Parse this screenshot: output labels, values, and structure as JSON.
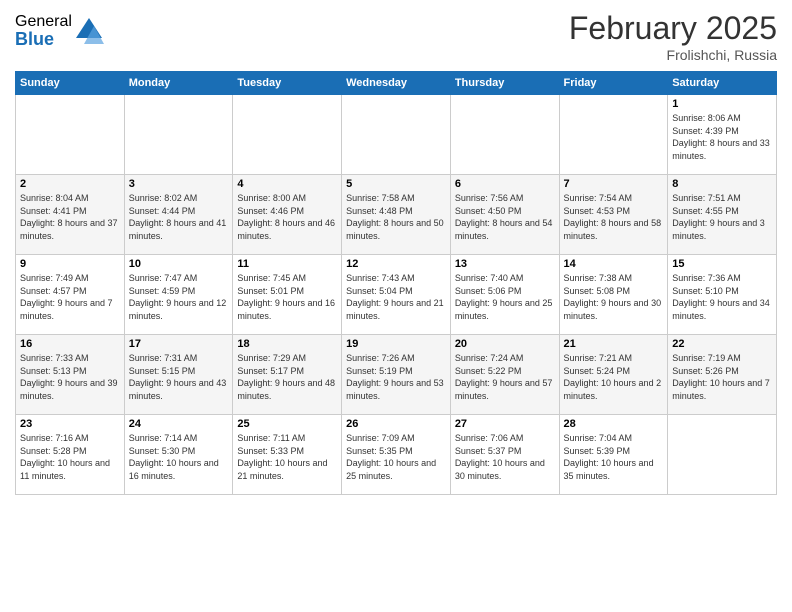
{
  "logo": {
    "general": "General",
    "blue": "Blue"
  },
  "title": {
    "month": "February 2025",
    "location": "Frolishchi, Russia"
  },
  "days_of_week": [
    "Sunday",
    "Monday",
    "Tuesday",
    "Wednesday",
    "Thursday",
    "Friday",
    "Saturday"
  ],
  "weeks": [
    [
      {
        "day": "",
        "info": ""
      },
      {
        "day": "",
        "info": ""
      },
      {
        "day": "",
        "info": ""
      },
      {
        "day": "",
        "info": ""
      },
      {
        "day": "",
        "info": ""
      },
      {
        "day": "",
        "info": ""
      },
      {
        "day": "1",
        "info": "Sunrise: 8:06 AM\nSunset: 4:39 PM\nDaylight: 8 hours and 33 minutes."
      }
    ],
    [
      {
        "day": "2",
        "info": "Sunrise: 8:04 AM\nSunset: 4:41 PM\nDaylight: 8 hours and 37 minutes."
      },
      {
        "day": "3",
        "info": "Sunrise: 8:02 AM\nSunset: 4:44 PM\nDaylight: 8 hours and 41 minutes."
      },
      {
        "day": "4",
        "info": "Sunrise: 8:00 AM\nSunset: 4:46 PM\nDaylight: 8 hours and 46 minutes."
      },
      {
        "day": "5",
        "info": "Sunrise: 7:58 AM\nSunset: 4:48 PM\nDaylight: 8 hours and 50 minutes."
      },
      {
        "day": "6",
        "info": "Sunrise: 7:56 AM\nSunset: 4:50 PM\nDaylight: 8 hours and 54 minutes."
      },
      {
        "day": "7",
        "info": "Sunrise: 7:54 AM\nSunset: 4:53 PM\nDaylight: 8 hours and 58 minutes."
      },
      {
        "day": "8",
        "info": "Sunrise: 7:51 AM\nSunset: 4:55 PM\nDaylight: 9 hours and 3 minutes."
      }
    ],
    [
      {
        "day": "9",
        "info": "Sunrise: 7:49 AM\nSunset: 4:57 PM\nDaylight: 9 hours and 7 minutes."
      },
      {
        "day": "10",
        "info": "Sunrise: 7:47 AM\nSunset: 4:59 PM\nDaylight: 9 hours and 12 minutes."
      },
      {
        "day": "11",
        "info": "Sunrise: 7:45 AM\nSunset: 5:01 PM\nDaylight: 9 hours and 16 minutes."
      },
      {
        "day": "12",
        "info": "Sunrise: 7:43 AM\nSunset: 5:04 PM\nDaylight: 9 hours and 21 minutes."
      },
      {
        "day": "13",
        "info": "Sunrise: 7:40 AM\nSunset: 5:06 PM\nDaylight: 9 hours and 25 minutes."
      },
      {
        "day": "14",
        "info": "Sunrise: 7:38 AM\nSunset: 5:08 PM\nDaylight: 9 hours and 30 minutes."
      },
      {
        "day": "15",
        "info": "Sunrise: 7:36 AM\nSunset: 5:10 PM\nDaylight: 9 hours and 34 minutes."
      }
    ],
    [
      {
        "day": "16",
        "info": "Sunrise: 7:33 AM\nSunset: 5:13 PM\nDaylight: 9 hours and 39 minutes."
      },
      {
        "day": "17",
        "info": "Sunrise: 7:31 AM\nSunset: 5:15 PM\nDaylight: 9 hours and 43 minutes."
      },
      {
        "day": "18",
        "info": "Sunrise: 7:29 AM\nSunset: 5:17 PM\nDaylight: 9 hours and 48 minutes."
      },
      {
        "day": "19",
        "info": "Sunrise: 7:26 AM\nSunset: 5:19 PM\nDaylight: 9 hours and 53 minutes."
      },
      {
        "day": "20",
        "info": "Sunrise: 7:24 AM\nSunset: 5:22 PM\nDaylight: 9 hours and 57 minutes."
      },
      {
        "day": "21",
        "info": "Sunrise: 7:21 AM\nSunset: 5:24 PM\nDaylight: 10 hours and 2 minutes."
      },
      {
        "day": "22",
        "info": "Sunrise: 7:19 AM\nSunset: 5:26 PM\nDaylight: 10 hours and 7 minutes."
      }
    ],
    [
      {
        "day": "23",
        "info": "Sunrise: 7:16 AM\nSunset: 5:28 PM\nDaylight: 10 hours and 11 minutes."
      },
      {
        "day": "24",
        "info": "Sunrise: 7:14 AM\nSunset: 5:30 PM\nDaylight: 10 hours and 16 minutes."
      },
      {
        "day": "25",
        "info": "Sunrise: 7:11 AM\nSunset: 5:33 PM\nDaylight: 10 hours and 21 minutes."
      },
      {
        "day": "26",
        "info": "Sunrise: 7:09 AM\nSunset: 5:35 PM\nDaylight: 10 hours and 25 minutes."
      },
      {
        "day": "27",
        "info": "Sunrise: 7:06 AM\nSunset: 5:37 PM\nDaylight: 10 hours and 30 minutes."
      },
      {
        "day": "28",
        "info": "Sunrise: 7:04 AM\nSunset: 5:39 PM\nDaylight: 10 hours and 35 minutes."
      },
      {
        "day": "",
        "info": ""
      }
    ]
  ]
}
